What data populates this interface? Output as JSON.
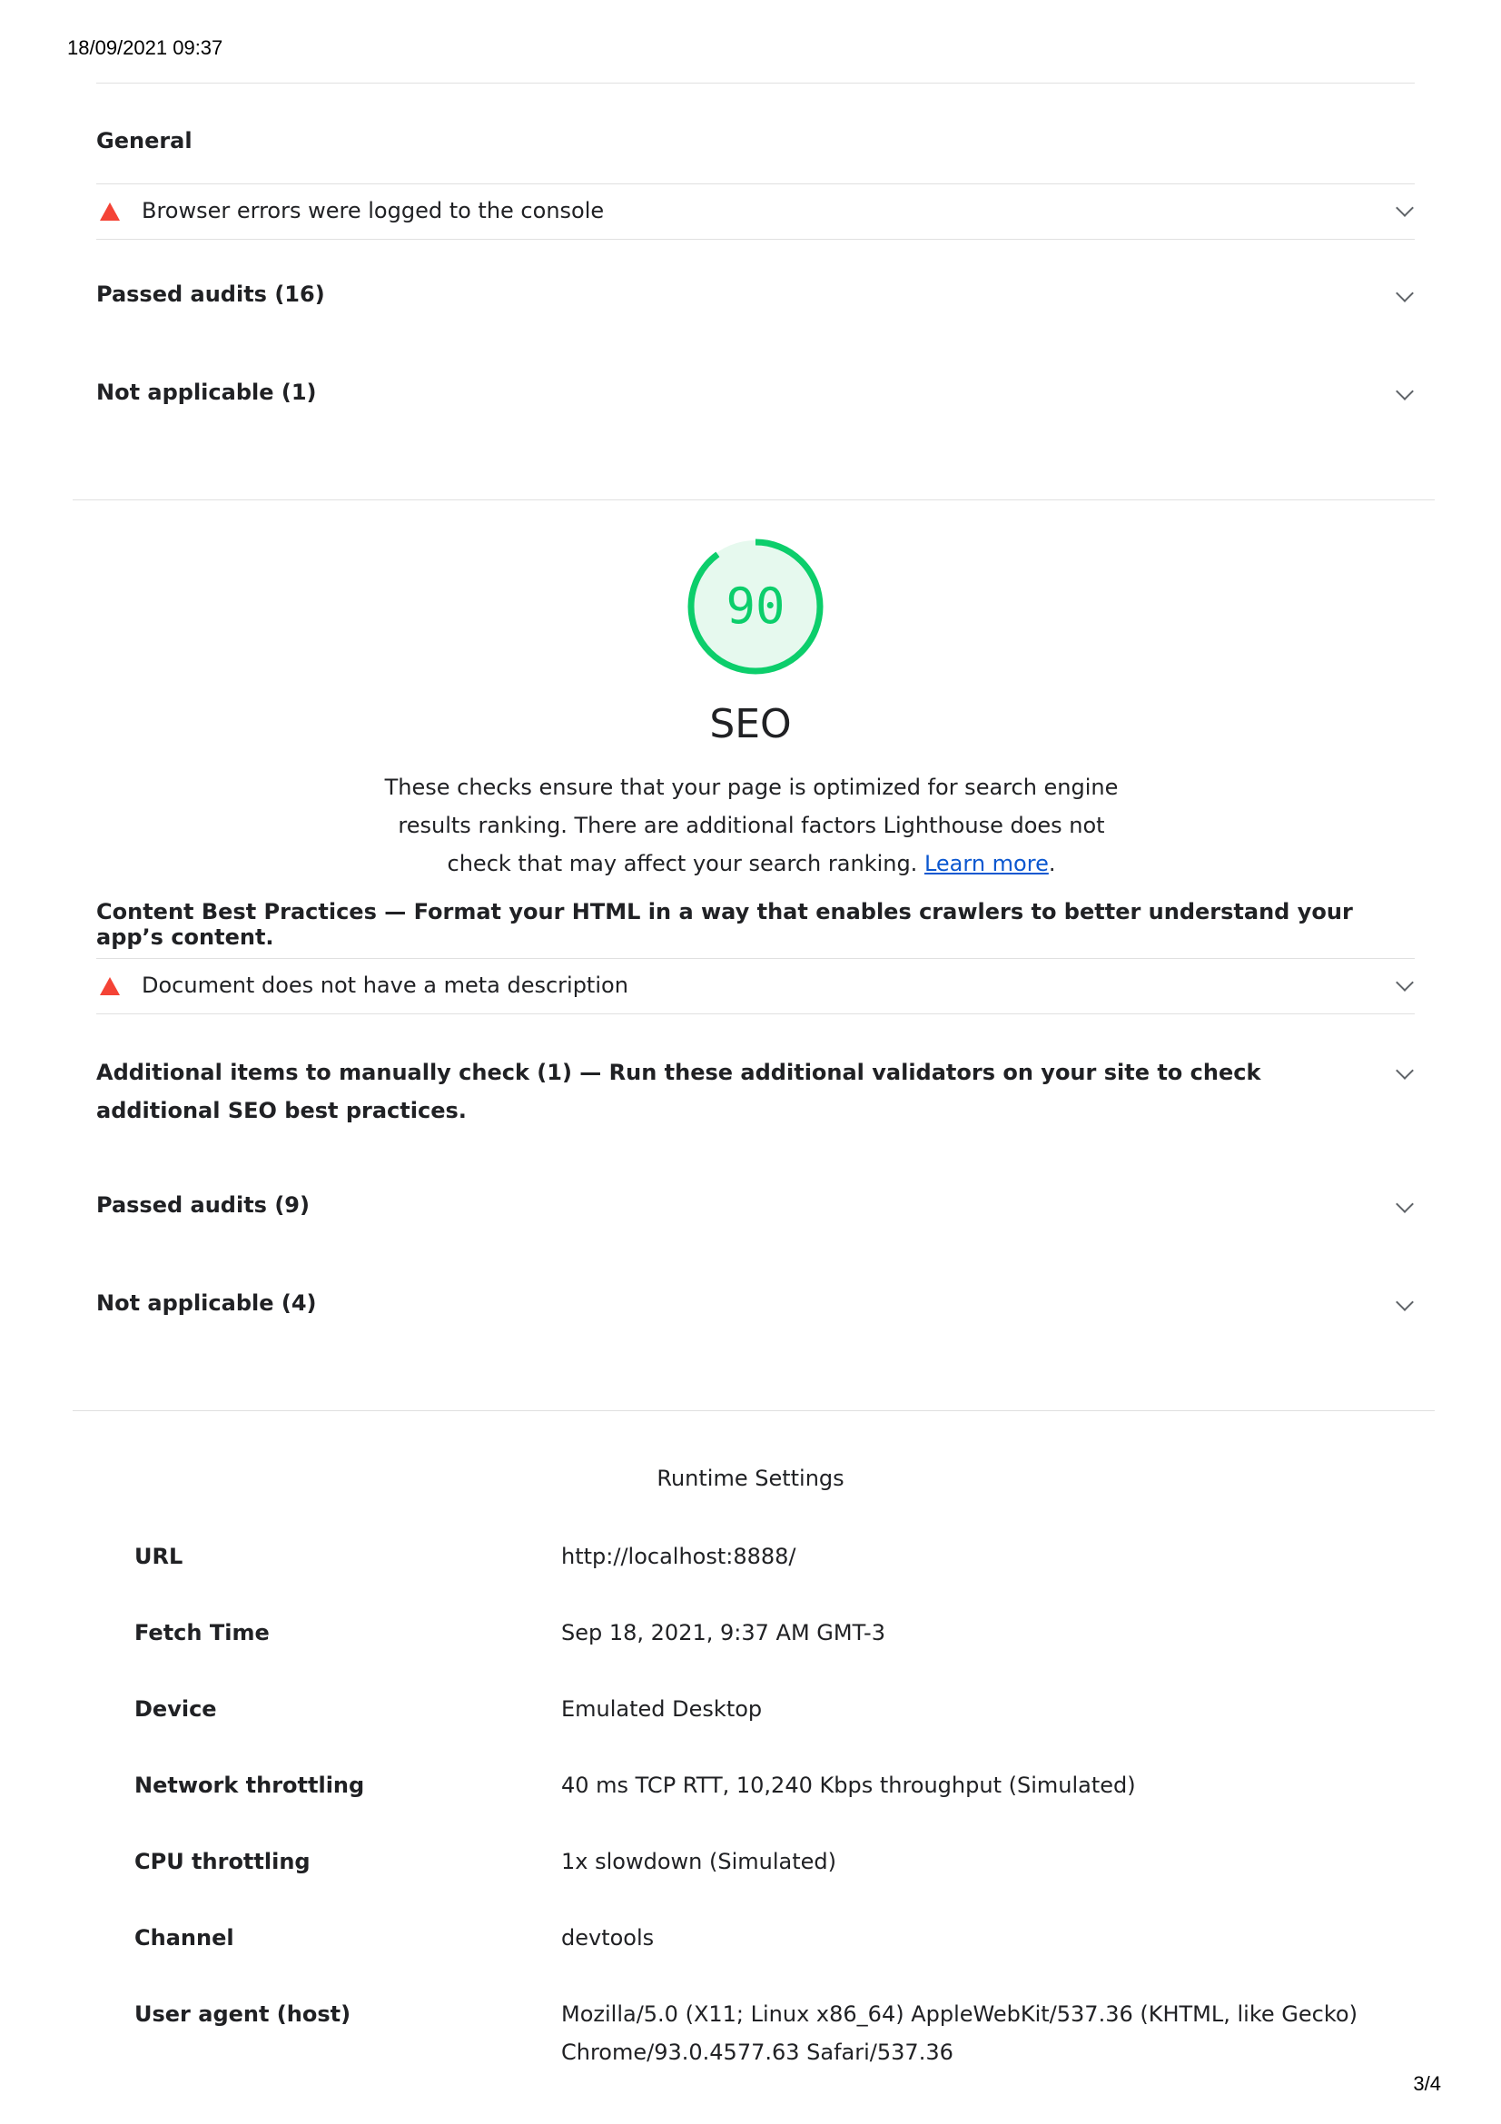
{
  "print": {
    "header_date": "18/09/2021 09:37",
    "page_number": "3/4"
  },
  "best_practices_tail": {
    "group_title": "General",
    "failed_audit": "Browser errors were logged to the console",
    "passed": "Passed audits (16)",
    "not_applicable": "Not applicable (1)"
  },
  "seo": {
    "score": "90",
    "score_fraction": 0.9,
    "title": "SEO",
    "description": "These checks ensure that your page is optimized for search engine results ranking. There are additional factors Lighthouse does not check that may affect your search ranking.",
    "learn_more": "Learn more",
    "content_group_title": "Content Best Practices",
    "content_group_sep": " — ",
    "content_group_desc": "Format your HTML in a way that enables crawlers to better understand your app’s content.",
    "failed_audit": "Document does not have a meta description",
    "manual_title": "Additional items to manually check (1)",
    "manual_sep": " — ",
    "manual_desc": "Run these additional validators on your site to check additional SEO best practices.",
    "passed": "Passed audits (9)",
    "not_applicable": "Not applicable (4)"
  },
  "runtime": {
    "title": "Runtime Settings",
    "rows": [
      {
        "label": "URL",
        "value": "http://localhost:8888/"
      },
      {
        "label": "Fetch Time",
        "value": "Sep 18, 2021, 9:37 AM GMT-3"
      },
      {
        "label": "Device",
        "value": "Emulated Desktop"
      },
      {
        "label": "Network throttling",
        "value": "40 ms TCP RTT, 10,240 Kbps throughput (Simulated)"
      },
      {
        "label": "CPU throttling",
        "value": "1x slowdown (Simulated)"
      },
      {
        "label": "Channel",
        "value": "devtools"
      },
      {
        "label": "User agent (host)",
        "value": "Mozilla/5.0 (X11; Linux x86_64) AppleWebKit/537.36 (KHTML, like Gecko) Chrome/93.0.4577.63 Safari/537.36"
      }
    ]
  },
  "colors": {
    "pass": "#0cce6b",
    "fail": "#f44336",
    "link": "#0b57d0"
  }
}
